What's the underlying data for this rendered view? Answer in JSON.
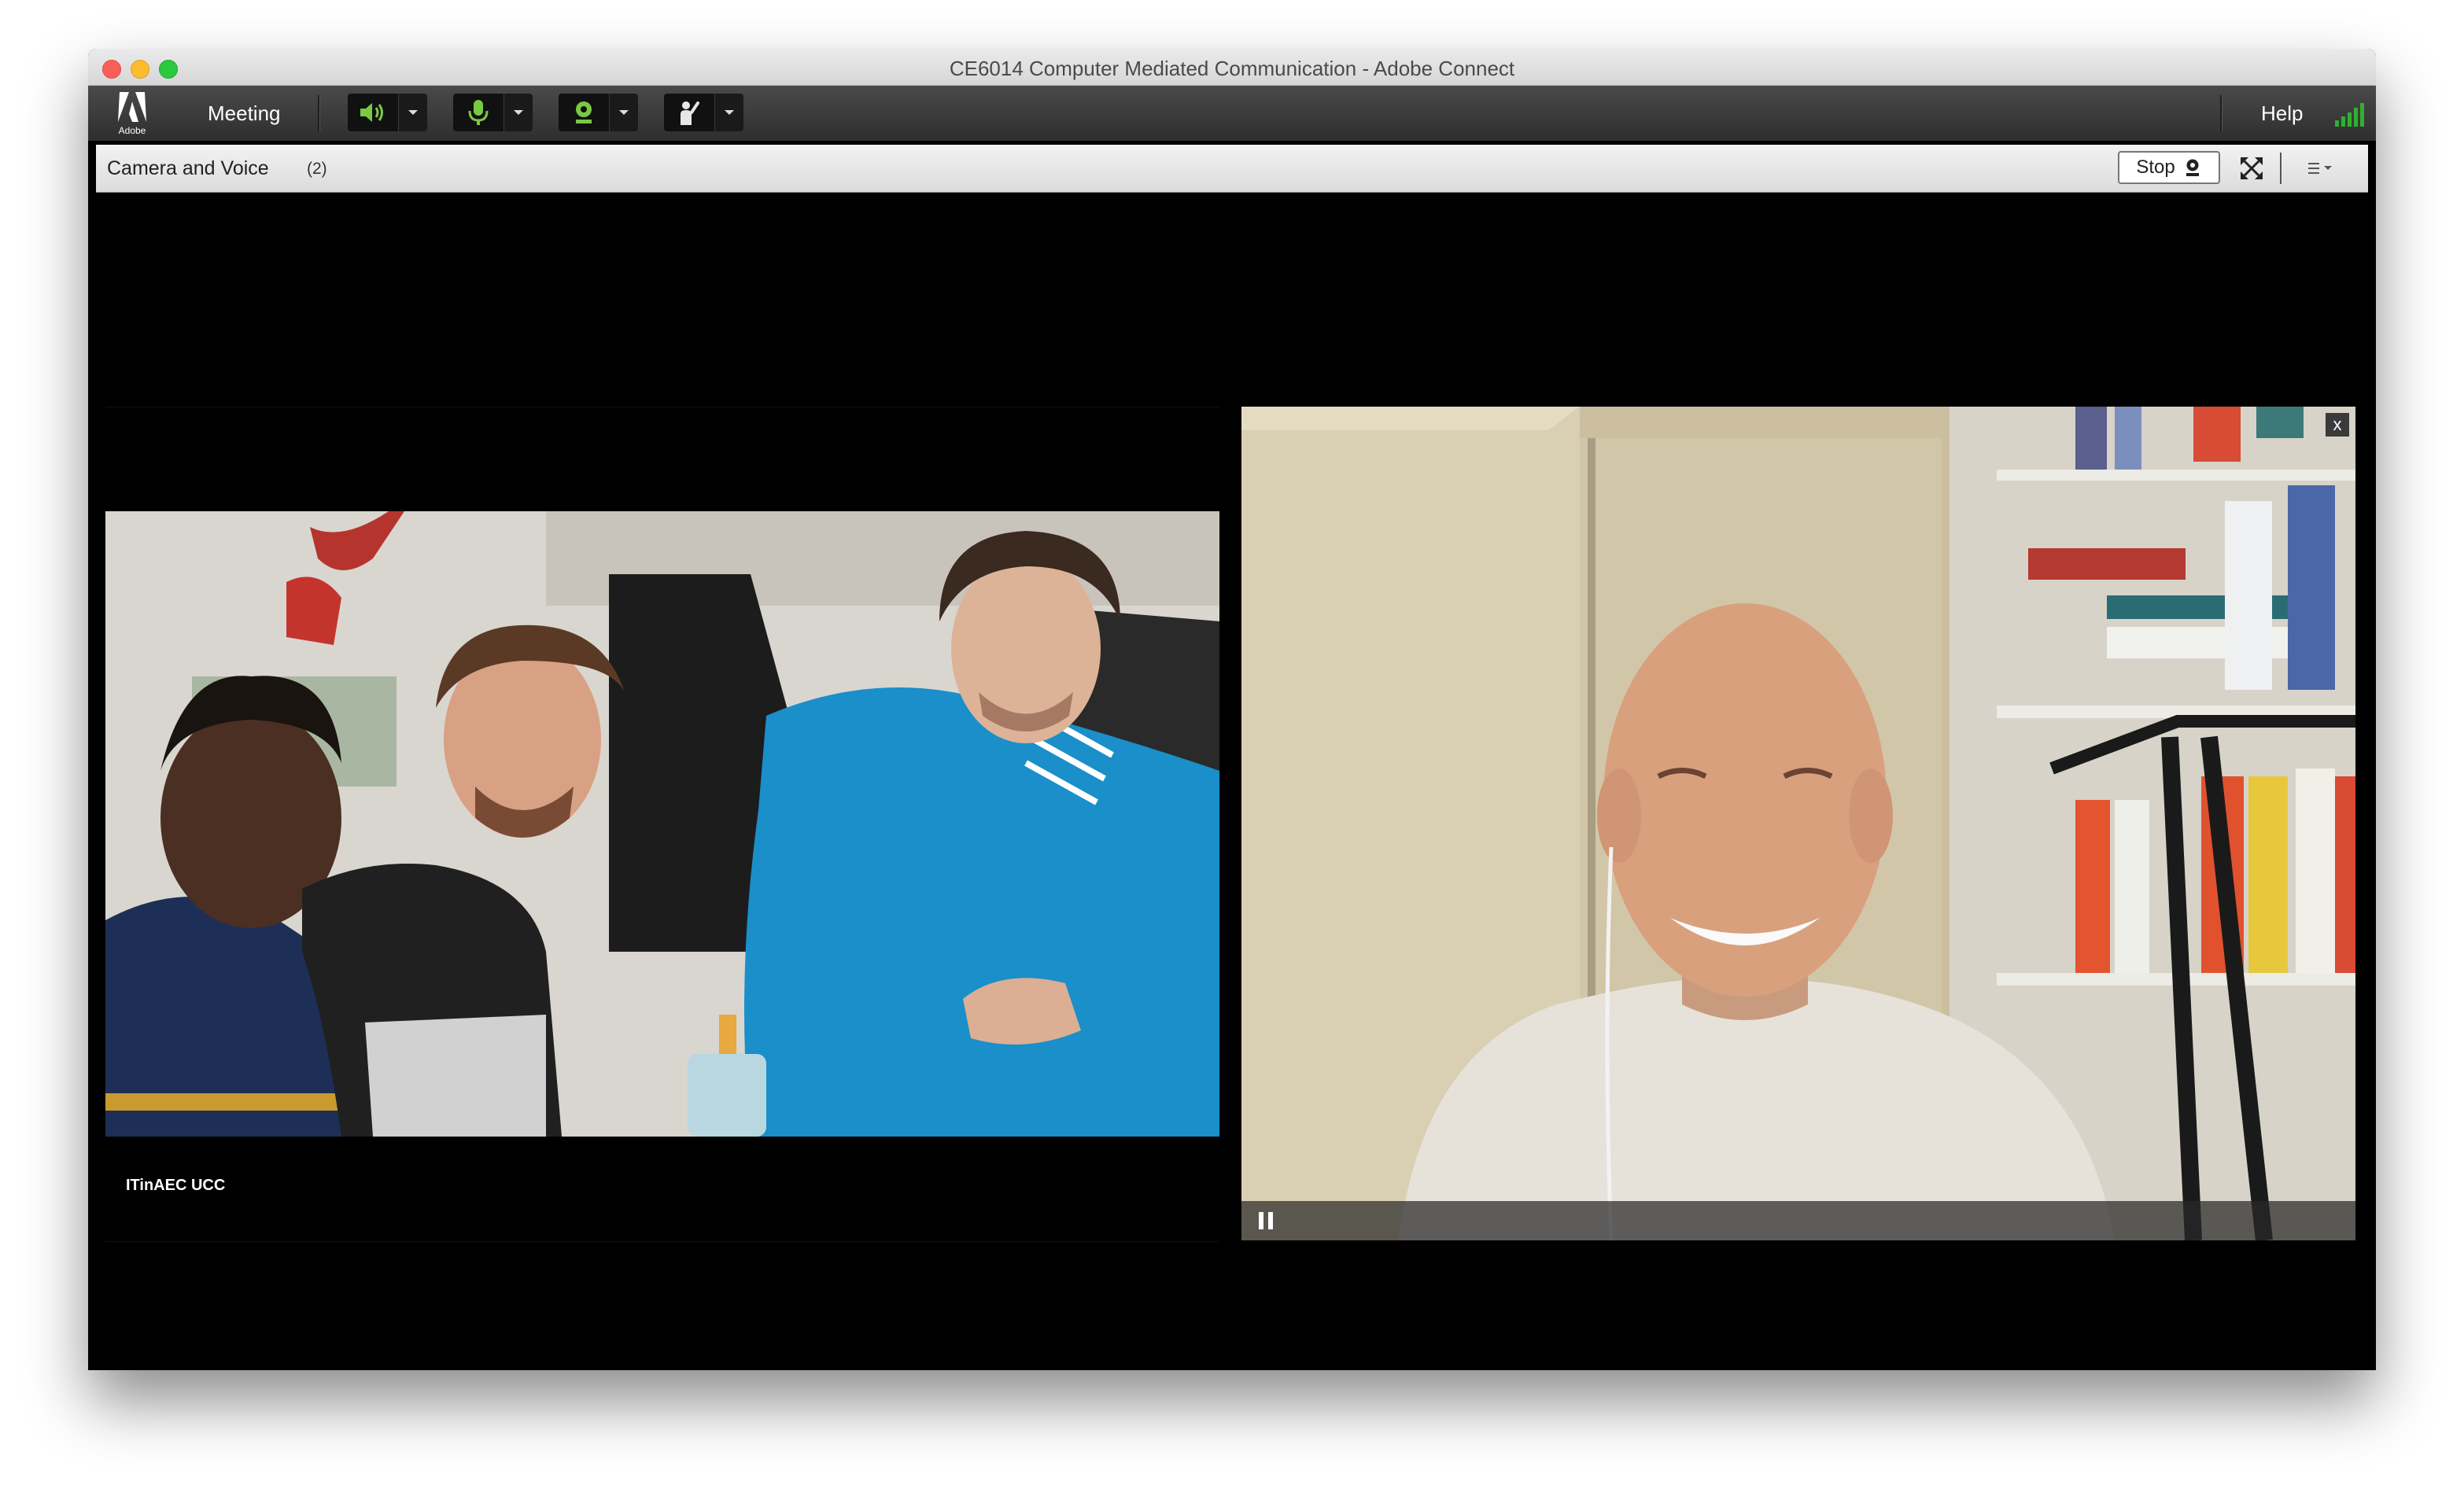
{
  "window": {
    "title": "CE6014 Computer Mediated Communication - Adobe Connect"
  },
  "toolbar": {
    "logo_text": "Adobe",
    "meeting_label": "Meeting",
    "help_label": "Help",
    "icons": [
      "speaker-icon",
      "microphone-icon",
      "webcam-icon",
      "raise-hand-icon",
      "signal-strength-icon"
    ],
    "accent_color": "#7ac943"
  },
  "pod": {
    "title": "Camera and Voice",
    "count": "(2)",
    "stop_label": "Stop"
  },
  "videos": [
    {
      "label": "ITinAEC UCC"
    },
    {
      "close_label": "x"
    }
  ]
}
